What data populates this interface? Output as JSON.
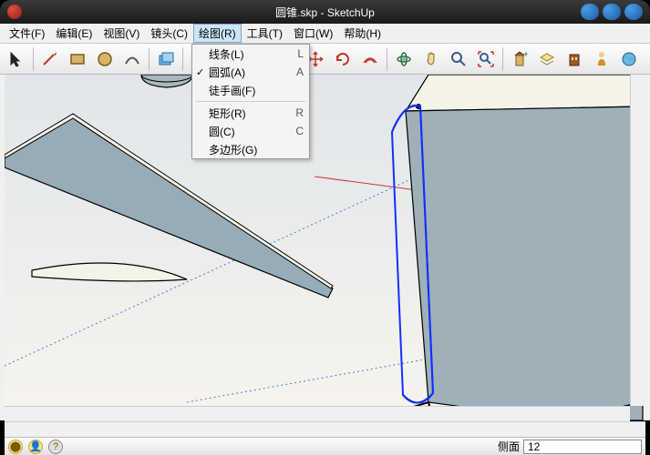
{
  "title": "圆锥.skp - SketchUp",
  "menubar": [
    "文件(F)",
    "编辑(E)",
    "视图(V)",
    "镜头(C)",
    "绘图(R)",
    "工具(T)",
    "窗口(W)",
    "帮助(H)"
  ],
  "menubar_open_index": 4,
  "dropdown": {
    "items": [
      {
        "label": "线条(L)",
        "shortcut": "L",
        "checked": false
      },
      {
        "label": "圆弧(A)",
        "shortcut": "A",
        "checked": true
      },
      {
        "label": "徒手画(F)",
        "shortcut": "",
        "checked": false
      }
    ],
    "items2": [
      {
        "label": "矩形(R)",
        "shortcut": "R",
        "checked": false
      },
      {
        "label": "圆(C)",
        "shortcut": "C",
        "checked": false
      },
      {
        "label": "多边形(G)",
        "shortcut": "",
        "checked": false
      }
    ]
  },
  "status": {
    "label": "侧面",
    "value": "12"
  },
  "icons": {
    "arrow": "select",
    "pencil": "line",
    "square": "rectangle",
    "circle": "circle",
    "arc": "arc",
    "eraser": "eraser",
    "tape": "tape",
    "push": "pushpull",
    "move": "move",
    "rotate": "rotate",
    "offset": "offset",
    "paint": "paint",
    "orbit": "orbit",
    "pan": "pan",
    "zoom": "zoom",
    "zoom-ext": "zoom-extents",
    "section": "section",
    "layers": "layers",
    "model": "model",
    "avatar": "person",
    "globe": "globe"
  }
}
